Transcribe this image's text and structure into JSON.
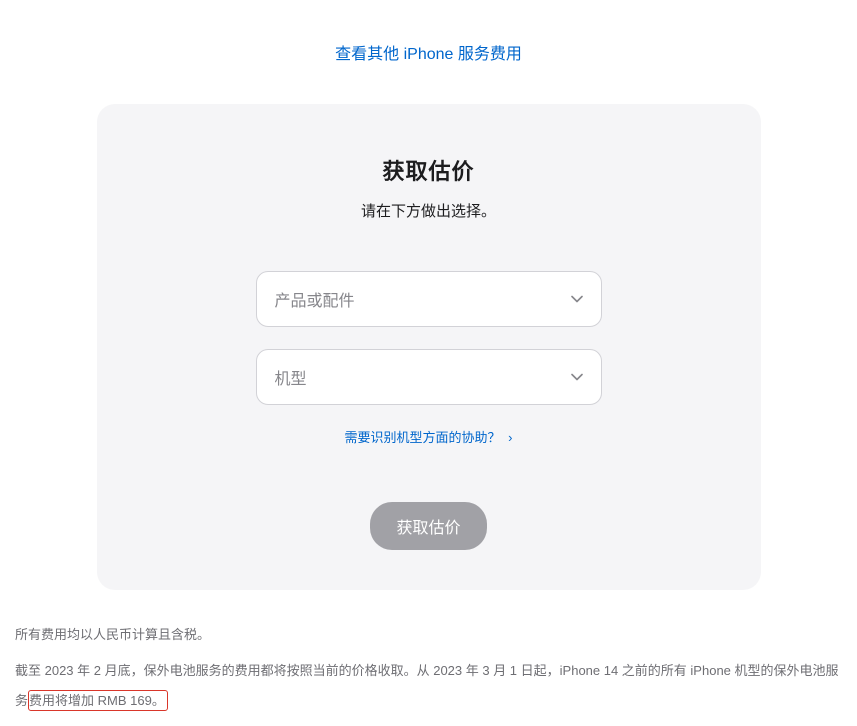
{
  "topLink": {
    "label": "查看其他 iPhone 服务费用"
  },
  "card": {
    "title": "获取估价",
    "subtitle": "请在下方做出选择。",
    "selectProduct": {
      "placeholder": "产品或配件"
    },
    "selectModel": {
      "placeholder": "机型"
    },
    "helpLink": {
      "label": "需要识别机型方面的协助？",
      "arrow": "›"
    },
    "submitButton": {
      "label": "获取估价"
    }
  },
  "footer": {
    "line1": "所有费用均以人民币计算且含税。",
    "line2Part1": "截至 2023 年 2 月底，保外电池服务的费用都将按照当前的价格收取。从 2023 年 3 月 1 日起，iPhone 14 之前的所有 iPhone 机型的保外电池服务",
    "line2HighlightedPart": "费用将增加 RMB 169。"
  }
}
